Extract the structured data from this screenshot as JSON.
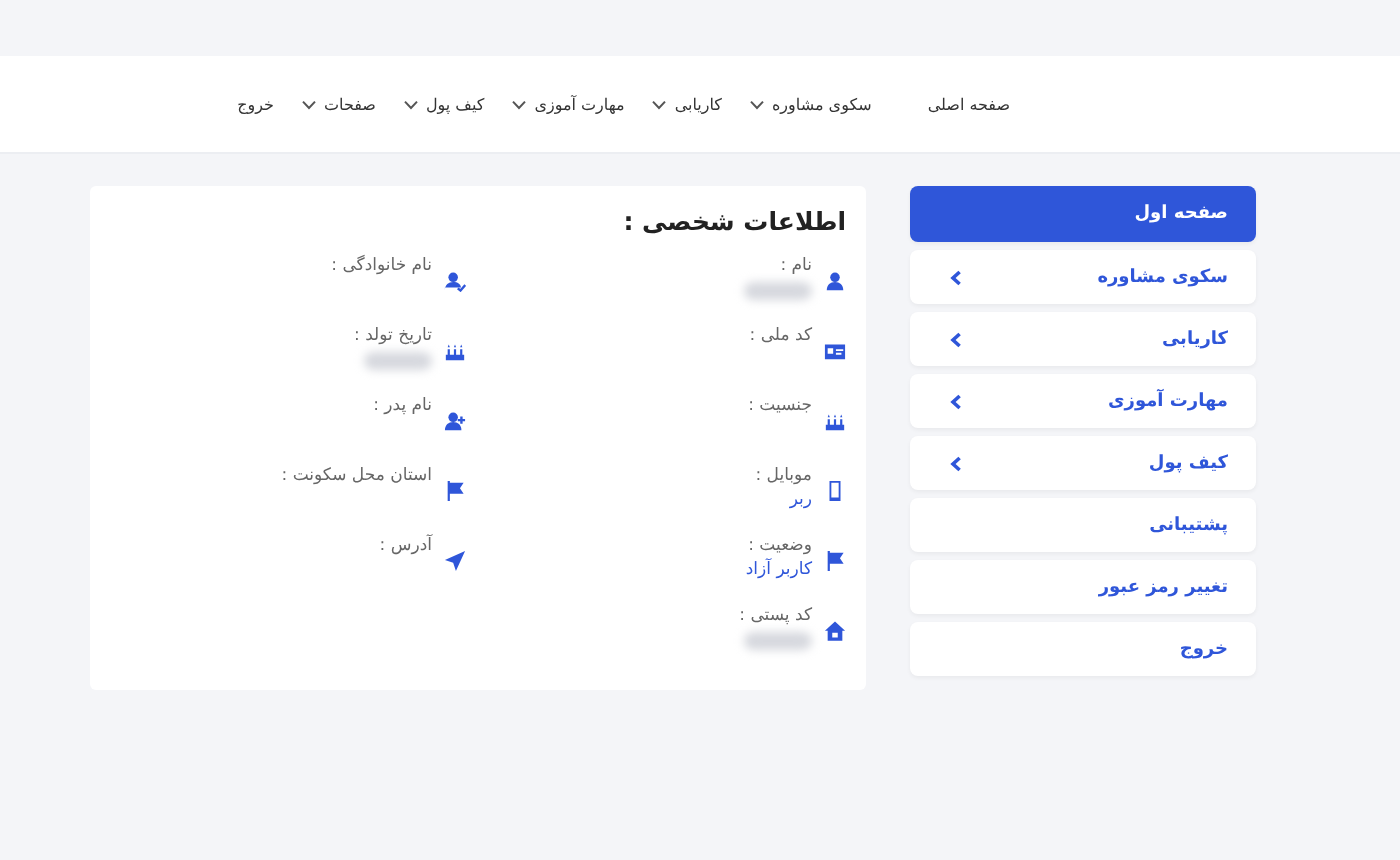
{
  "nav": [
    {
      "label": "صفحه اصلی",
      "dropdown": false
    },
    {
      "label": "سکوی مشاوره",
      "dropdown": true
    },
    {
      "label": "کاریابی",
      "dropdown": true
    },
    {
      "label": "مهارت آموزی",
      "dropdown": true
    },
    {
      "label": "کیف پول",
      "dropdown": true
    },
    {
      "label": "صفحات",
      "dropdown": true
    },
    {
      "label": "خروج",
      "dropdown": false
    }
  ],
  "sidebar": {
    "items": [
      {
        "label": "صفحه اول",
        "selected": true,
        "expandable": false
      },
      {
        "label": "سکوی مشاوره",
        "selected": false,
        "expandable": true
      },
      {
        "label": "کاریابی",
        "selected": false,
        "expandable": true
      },
      {
        "label": "مهارت آموزی",
        "selected": false,
        "expandable": true
      },
      {
        "label": "کیف پول",
        "selected": false,
        "expandable": true
      },
      {
        "label": "پشتیبانی",
        "selected": false,
        "expandable": false
      },
      {
        "label": "تغییر رمز عبور",
        "selected": false,
        "expandable": false
      },
      {
        "label": "خروج",
        "selected": false,
        "expandable": false
      }
    ]
  },
  "profile": {
    "title": "اطلاعات شخصی :",
    "columns": [
      [
        {
          "label": "نام :",
          "kind": "blurred"
        },
        {
          "label": "کد ملی :",
          "kind": "empty"
        },
        {
          "label": "جنسیت :",
          "kind": "empty"
        },
        {
          "label": "موبایل :",
          "kind": "text",
          "value": "ربر"
        },
        {
          "label": "وضعیت :",
          "kind": "text",
          "value": "کاربر آزاد"
        },
        {
          "label": "کد پستی :",
          "kind": "blurred"
        }
      ],
      [
        {
          "label": "نام خانوادگی :",
          "kind": "empty"
        },
        {
          "label": "تاریخ تولد :",
          "kind": "blurred"
        },
        {
          "label": "نام پدر :",
          "kind": "empty"
        },
        {
          "label": "استان محل سکونت :",
          "kind": "empty"
        },
        {
          "label": "آدرس :",
          "kind": "empty"
        }
      ]
    ]
  }
}
